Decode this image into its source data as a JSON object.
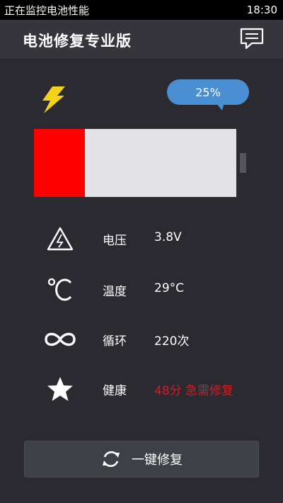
{
  "status_bar": {
    "left_text": "正在监控电池性能",
    "time": "18:30"
  },
  "header": {
    "title": "电池修复专业版",
    "message_icon": "chat-bubble-icon"
  },
  "battery": {
    "percent_label": "25%",
    "level": 0.25,
    "fill_color": "#ff0000",
    "empty_color": "#e3e3e5"
  },
  "stats": [
    {
      "icon": "voltage-warning-icon",
      "label": "电压",
      "value": "3.8V",
      "alert": false
    },
    {
      "icon": "celsius-icon",
      "label": "温度",
      "value": "29°C",
      "alert": false
    },
    {
      "icon": "infinity-icon",
      "label": "循环",
      "value": "220次",
      "alert": false
    },
    {
      "icon": "star-icon",
      "label": "健康",
      "value": "48分 急需修复",
      "alert": true
    }
  ],
  "repair_button": {
    "label": "一键修复",
    "icon": "refresh-icon"
  },
  "colors": {
    "accent_blue": "#4a8fd1",
    "bolt_yellow": "#f4d21c",
    "alert_red": "#e8121b",
    "background": "#2a2a30"
  }
}
